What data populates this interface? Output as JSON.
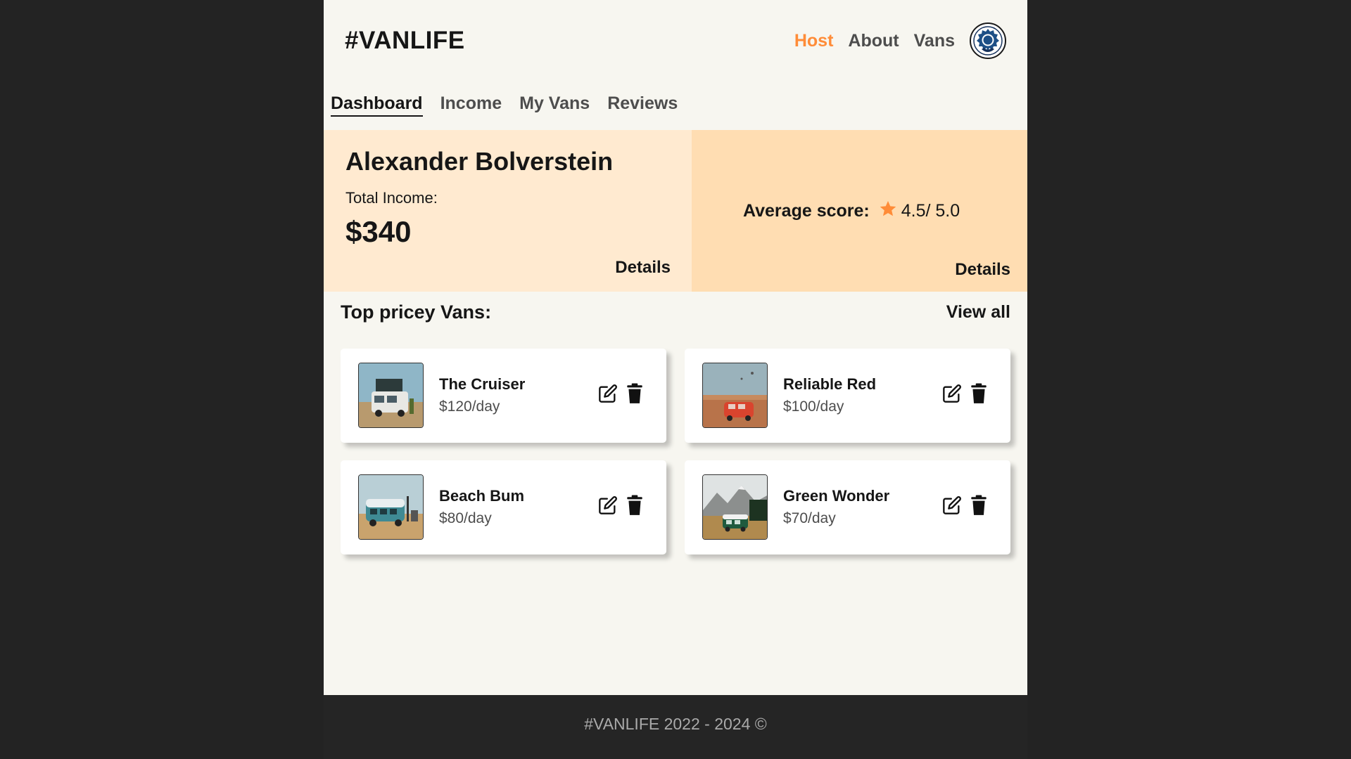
{
  "header": {
    "logo": "#VANLIFE",
    "nav": [
      {
        "label": "Host",
        "active": true
      },
      {
        "label": "About",
        "active": false
      },
      {
        "label": "Vans",
        "active": false
      }
    ]
  },
  "host_nav": [
    {
      "label": "Dashboard",
      "active": true
    },
    {
      "label": "Income",
      "active": false
    },
    {
      "label": "My Vans",
      "active": false
    },
    {
      "label": "Reviews",
      "active": false
    }
  ],
  "income": {
    "host_name": "Alexander Bolverstein",
    "label": "Total Income:",
    "value": "$340",
    "details_label": "Details"
  },
  "score": {
    "label": "Average score:",
    "value": "4.5/ 5.0",
    "details_label": "Details"
  },
  "vans_section": {
    "title": "Top pricey Vans:",
    "view_all_label": "View all",
    "vans": [
      {
        "name": "The Cruiser",
        "price": "$120/day"
      },
      {
        "name": "Reliable Red",
        "price": "$100/day"
      },
      {
        "name": "Beach Bum",
        "price": "$80/day"
      },
      {
        "name": "Green Wonder",
        "price": "$70/day"
      }
    ]
  },
  "footer": {
    "text": "#VANLIFE 2022 - 2024 ©"
  },
  "colors": {
    "accent": "#ff8c38",
    "page_bg": "#f7f6f0",
    "income_panel_bg": "#ffead0",
    "score_panel_bg": "#ffddb2",
    "outer_bg": "#232323",
    "footer_bg": "#252525",
    "star": "#ff8c38"
  },
  "icons": {
    "avatar": "host-avatar-icon",
    "star": "star-icon",
    "edit": "edit-icon",
    "delete": "trash-icon"
  }
}
